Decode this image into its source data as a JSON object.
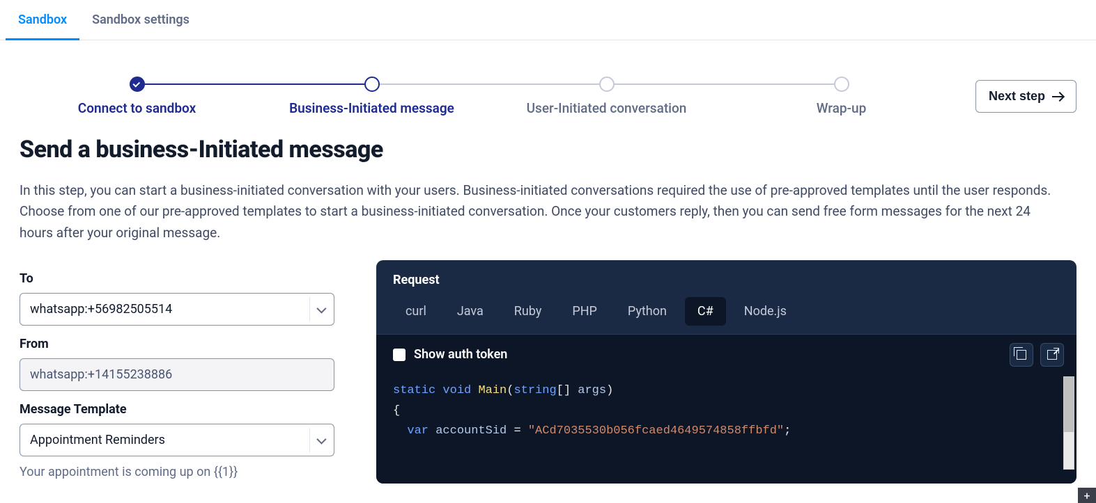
{
  "tabs": {
    "sandbox": "Sandbox",
    "settings": "Sandbox settings"
  },
  "stepper": {
    "steps": [
      {
        "label": "Connect to sandbox"
      },
      {
        "label": "Business-Initiated message"
      },
      {
        "label": "User-Initiated conversation"
      },
      {
        "label": "Wrap-up"
      }
    ],
    "next_button": "Next step"
  },
  "heading": "Send a business-Initiated message",
  "description": "In this step, you can start a business-initiated conversation with your users. Business-initiated conversations required the use of pre-approved templates until the user responds. Choose from one of our pre-approved templates to start a business-initiated conversation. Once your customers reply, then you can send free form messages for the next 24 hours after your original message.",
  "form": {
    "to_label": "To",
    "to_value": "whatsapp:+56982505514",
    "from_label": "From",
    "from_value": "whatsapp:+14155238886",
    "template_label": "Message Template",
    "template_value": "Appointment Reminders",
    "template_hint": "Your appointment is coming up on {{1}}"
  },
  "code_panel": {
    "title": "Request",
    "languages": [
      "curl",
      "Java",
      "Ruby",
      "PHP",
      "Python",
      "C#",
      "Node.js"
    ],
    "active_language": "C#",
    "show_auth_label": "Show auth token",
    "show_auth_checked": false,
    "code": {
      "line1_kw1": "static",
      "line1_kw2": "void",
      "line1_fn": "Main",
      "line1_type": "string",
      "line1_arr": "[]",
      "line1_arg": "args",
      "line2_brace": "{",
      "line3_kw": "var",
      "line3_var": "accountSid",
      "line3_eq": "=",
      "line3_str": "\"ACd7035530b056fcaed4649574858ffbfd\"",
      "line3_semi": ";"
    }
  }
}
